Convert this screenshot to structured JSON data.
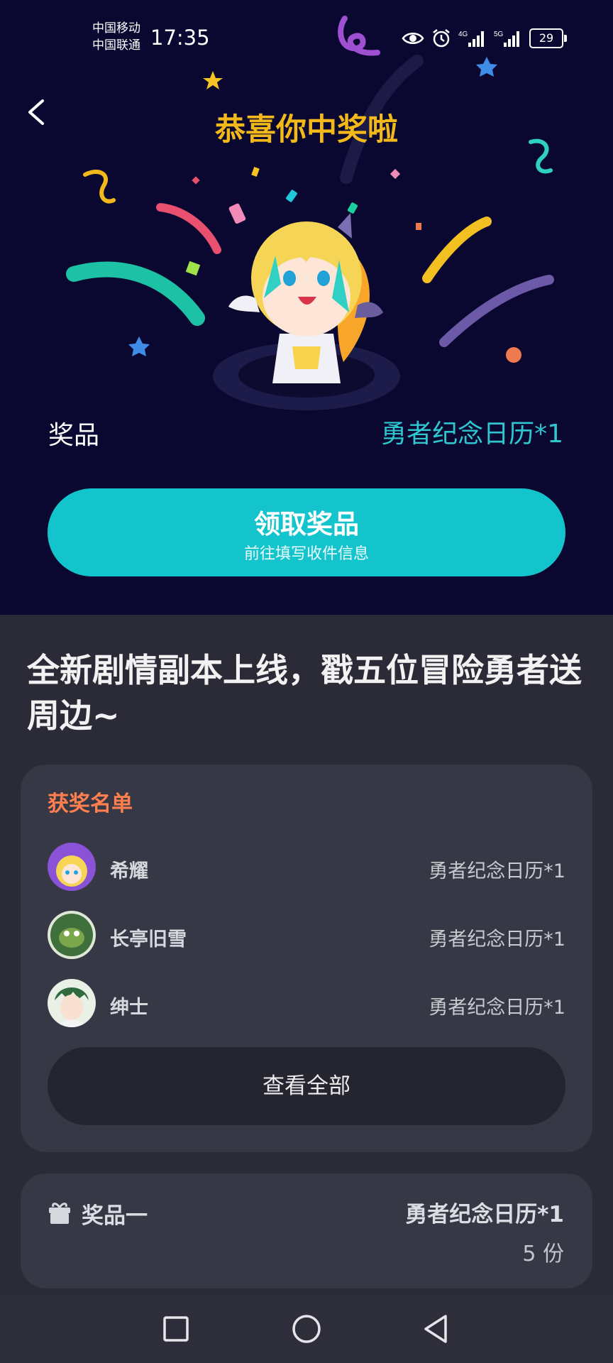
{
  "status_bar": {
    "carrier_1": "中国移动",
    "carrier_2": "中国联通",
    "time": "17:35",
    "network_1": "4G",
    "network_2": "5G",
    "battery": "29",
    "icons": [
      "eye-icon",
      "alarm-icon",
      "signal-icon",
      "signal-icon",
      "battery-icon"
    ]
  },
  "header": {
    "title": "恭喜你中奖啦"
  },
  "prize": {
    "label": "奖品",
    "value": "勇者纪念日历*1"
  },
  "claim_button": {
    "label": "领取奖品",
    "sublabel": "前往填写收件信息"
  },
  "event": {
    "headline": "全新剧情副本上线，戳五位冒险勇者送周边~"
  },
  "winners": {
    "title": "获奖名单",
    "list": [
      {
        "name": "希耀",
        "prize": "勇者纪念日历*1"
      },
      {
        "name": "长亭旧雪",
        "prize": "勇者纪念日历*1"
      },
      {
        "name": "绅士",
        "prize": "勇者纪念日历*1"
      }
    ],
    "view_all": "查看全部"
  },
  "prize_card": {
    "label": "奖品一",
    "name": "勇者纪念日历*1",
    "quantity": "5 份"
  },
  "colors": {
    "hero_bg": "#0a0830",
    "accent": "#14c4cd",
    "title": "#f3b91b",
    "winners_title": "#ff7f4f"
  }
}
